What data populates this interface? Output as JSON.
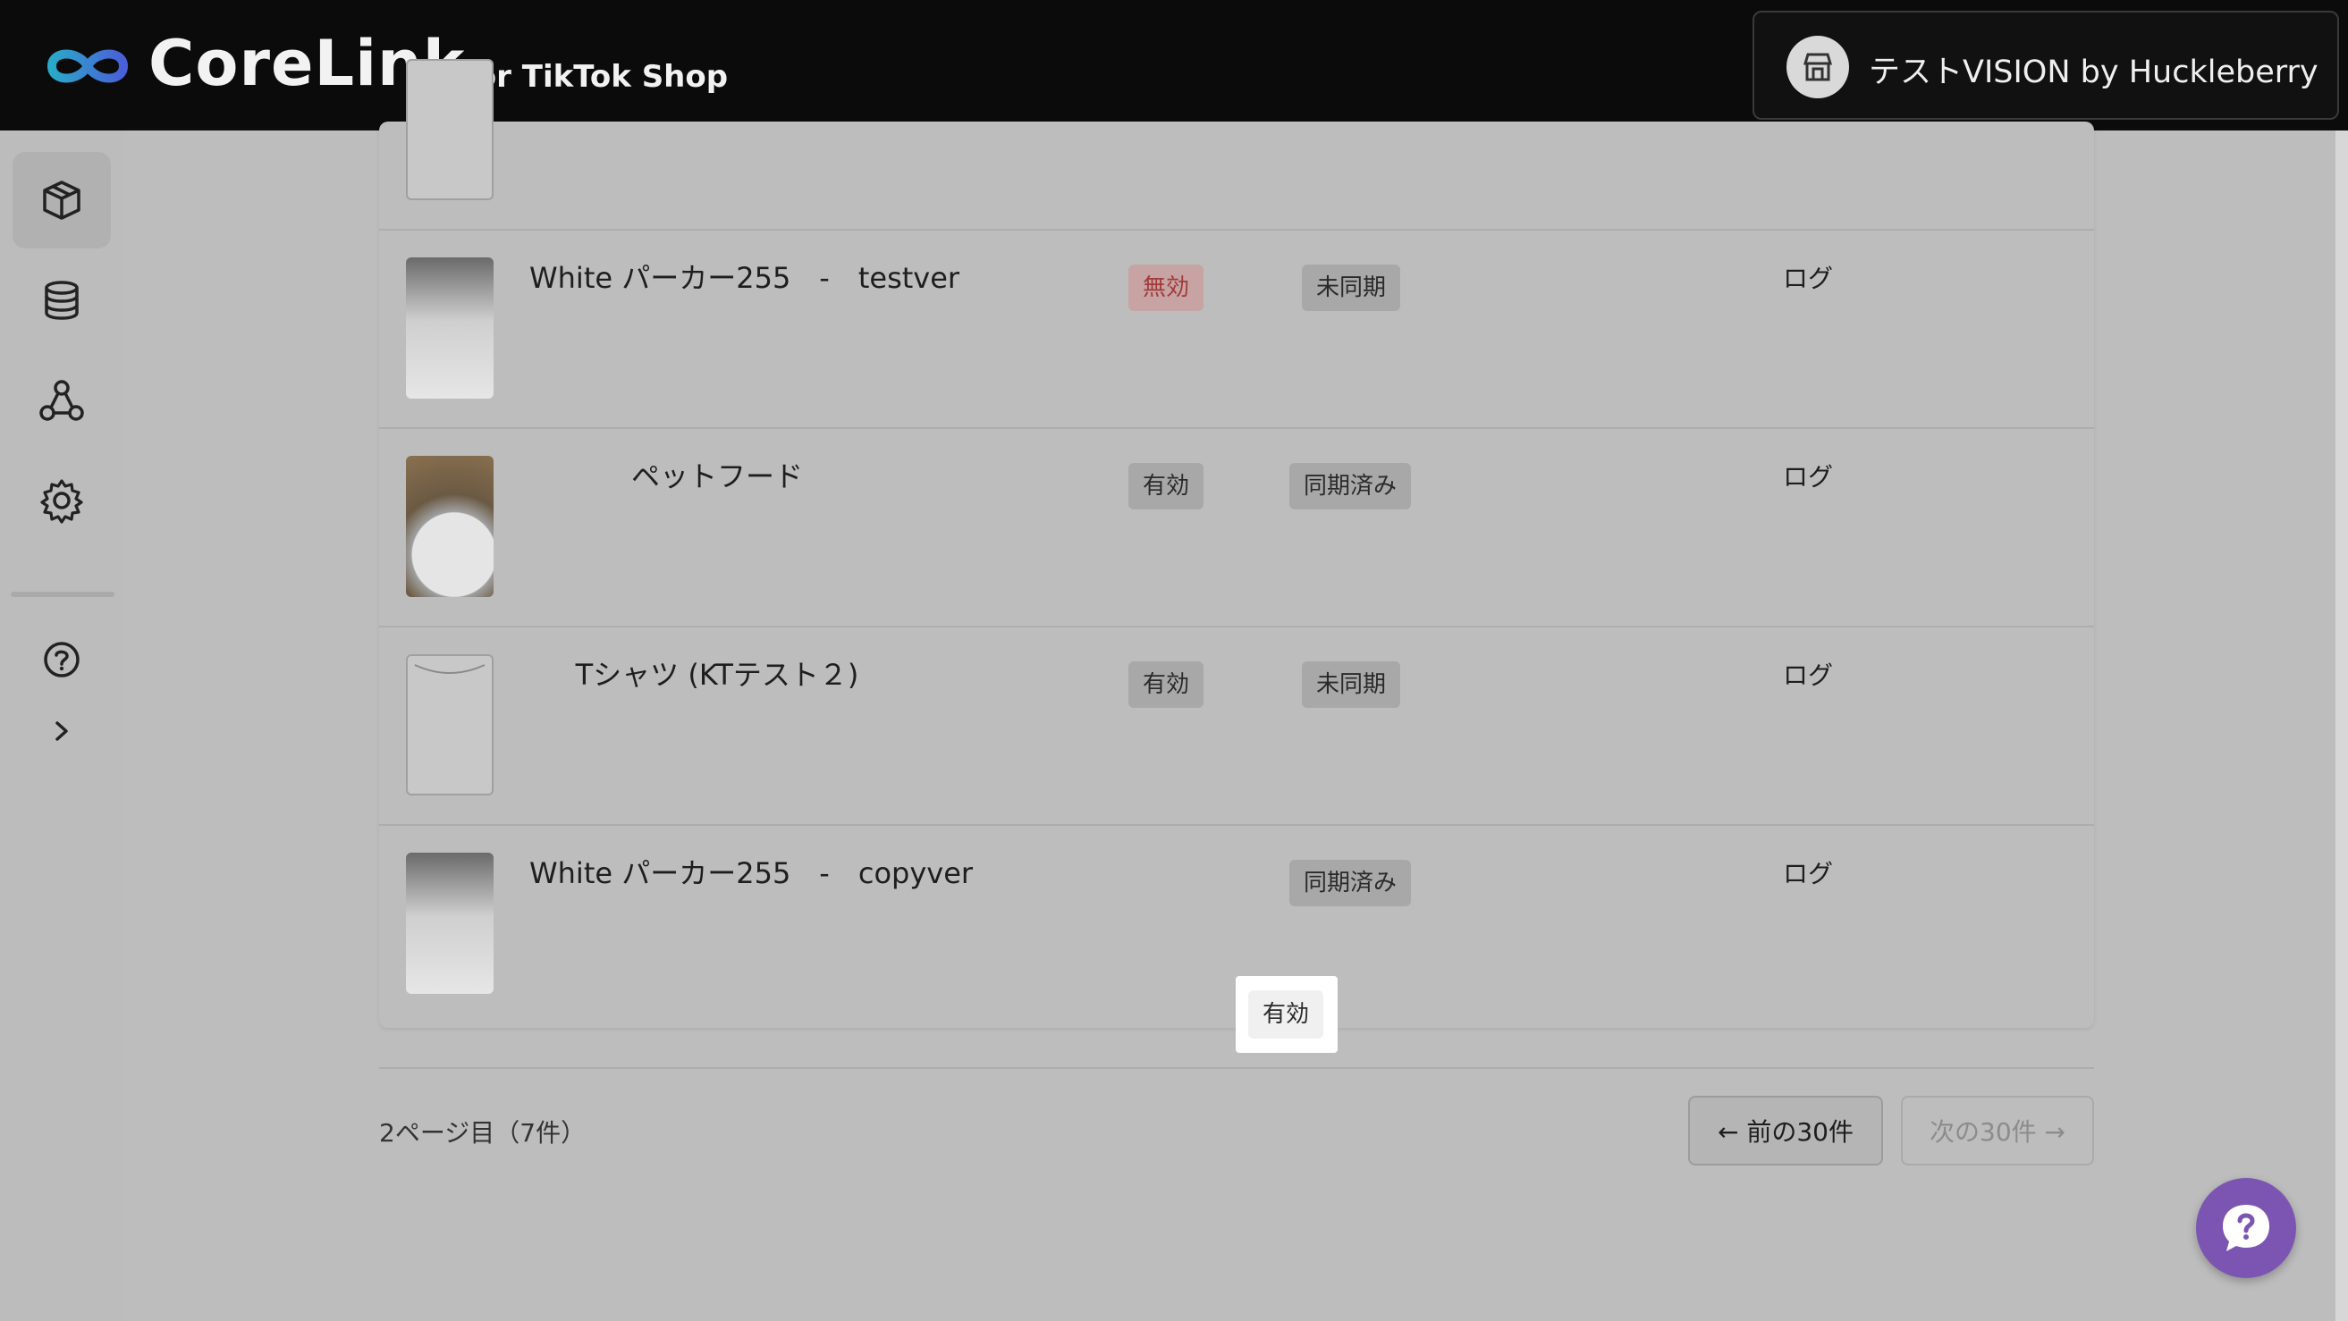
{
  "header": {
    "logo": "CoreLink",
    "logo_sub": "for TikTok Shop",
    "shop_name": "テストVISION by Huckleberry"
  },
  "sidebar": {
    "items": [
      {
        "name": "products",
        "icon": "box-icon",
        "active": true
      },
      {
        "name": "database",
        "icon": "database-icon",
        "active": false
      },
      {
        "name": "integrations",
        "icon": "network-icon",
        "active": false
      },
      {
        "name": "settings",
        "icon": "gear-icon",
        "active": false
      },
      {
        "name": "help",
        "icon": "question-icon",
        "active": false
      },
      {
        "name": "expand",
        "icon": "chevron-right-icon",
        "active": false
      }
    ]
  },
  "rows": [
    {
      "name": "White パーカー255　-　testver",
      "status": "無効",
      "status_type": "invalid",
      "sync": "未同期",
      "log": "ログ",
      "thumb": "photo"
    },
    {
      "name": "ペットフード",
      "status": "有効",
      "status_type": "valid",
      "sync": "同期済み",
      "log": "ログ",
      "thumb": "food"
    },
    {
      "name": "Tシャツ (KTテスト２)",
      "status": "有効",
      "status_type": "valid",
      "sync": "未同期",
      "log": "ログ",
      "thumb": "tshirt"
    },
    {
      "name": "White パーカー255　-　copyver",
      "status": "有効",
      "status_type": "valid",
      "sync": "同期済み",
      "log": "ログ",
      "thumb": "photo"
    }
  ],
  "pagination": {
    "info": "2ページ目（7件）",
    "prev": "← 前の30件",
    "next": "次の30件 →"
  },
  "colors": {
    "accent": "#7c55b3",
    "header_bg": "#0b0b0b",
    "invalid_text": "#a23a3a"
  }
}
